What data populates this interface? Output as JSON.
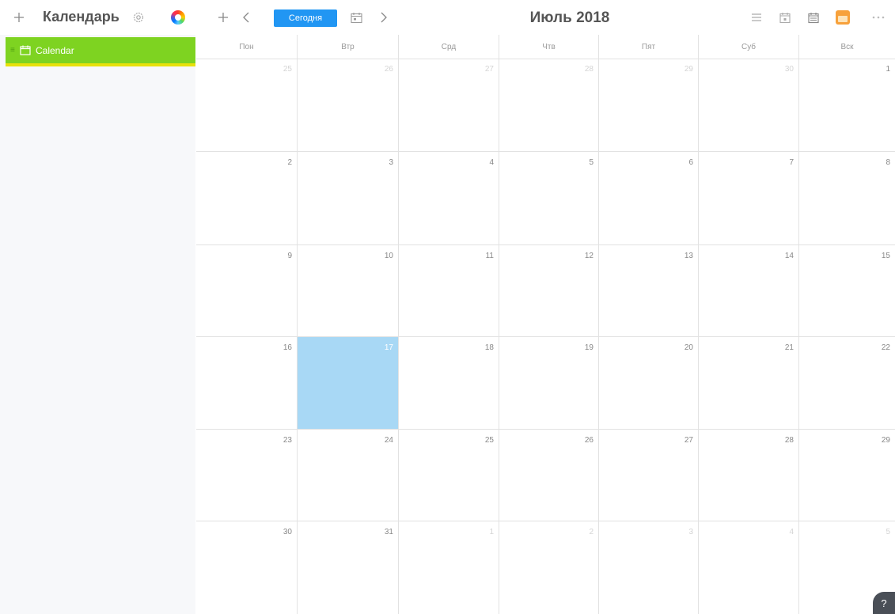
{
  "app": {
    "title": "Календарь"
  },
  "toolbar": {
    "today_label": "Сегодня",
    "month_title": "Июль 2018"
  },
  "sidebar": {
    "items": [
      {
        "label": "Calendar",
        "color": "#7ed321"
      }
    ]
  },
  "weekdays": [
    "Пон",
    "Втр",
    "Срд",
    "Чтв",
    "Пят",
    "Суб",
    "Вск"
  ],
  "weeks": [
    [
      {
        "d": "25",
        "other": true
      },
      {
        "d": "26",
        "other": true
      },
      {
        "d": "27",
        "other": true
      },
      {
        "d": "28",
        "other": true
      },
      {
        "d": "29",
        "other": true
      },
      {
        "d": "30",
        "other": true
      },
      {
        "d": "1"
      }
    ],
    [
      {
        "d": "2"
      },
      {
        "d": "3"
      },
      {
        "d": "4"
      },
      {
        "d": "5"
      },
      {
        "d": "6"
      },
      {
        "d": "7"
      },
      {
        "d": "8"
      }
    ],
    [
      {
        "d": "9"
      },
      {
        "d": "10"
      },
      {
        "d": "11"
      },
      {
        "d": "12"
      },
      {
        "d": "13"
      },
      {
        "d": "14"
      },
      {
        "d": "15"
      }
    ],
    [
      {
        "d": "16"
      },
      {
        "d": "17",
        "today": true
      },
      {
        "d": "18"
      },
      {
        "d": "19"
      },
      {
        "d": "20"
      },
      {
        "d": "21"
      },
      {
        "d": "22"
      }
    ],
    [
      {
        "d": "23"
      },
      {
        "d": "24"
      },
      {
        "d": "25"
      },
      {
        "d": "26"
      },
      {
        "d": "27"
      },
      {
        "d": "28"
      },
      {
        "d": "29"
      }
    ],
    [
      {
        "d": "30"
      },
      {
        "d": "31"
      },
      {
        "d": "1",
        "other": true
      },
      {
        "d": "2",
        "other": true
      },
      {
        "d": "3",
        "other": true
      },
      {
        "d": "4",
        "other": true
      },
      {
        "d": "5",
        "other": true
      }
    ]
  ],
  "colors": {
    "accent": "#2196f3",
    "today": "#a8d8f5",
    "calendar": "#7ed321"
  },
  "icons": [
    "plus-icon",
    "gear-icon",
    "color-wheel-icon",
    "chevron-left-icon",
    "calendar-icon",
    "chevron-right-icon",
    "list-icon",
    "day-view-icon",
    "month-view-icon",
    "orange-calendar-icon",
    "more-icon",
    "help-icon"
  ]
}
